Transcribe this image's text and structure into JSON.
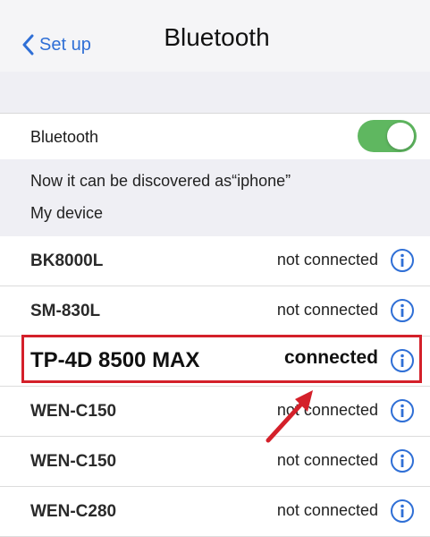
{
  "nav": {
    "back_label": "Set up",
    "title": "Bluetooth"
  },
  "bluetooth_toggle": {
    "label": "Bluetooth",
    "state": "on",
    "color": "#5fb760"
  },
  "discoverable_text": "Now it can be discovered as“iphone”",
  "section_header": "My device",
  "devices": [
    {
      "name": "BK8000L",
      "status": "not connected"
    },
    {
      "name": "SM-830L",
      "status": "not connected"
    },
    {
      "name": "TP-4D 8500 MAX",
      "status": "connected"
    },
    {
      "name": "WEN-C150",
      "status": "not connected"
    },
    {
      "name": "WEN-C150",
      "status": "not connected"
    },
    {
      "name": "WEN-C280",
      "status": "not connected"
    }
  ],
  "accent_color": "#2f6fd6",
  "highlight_color": "#d4202a"
}
